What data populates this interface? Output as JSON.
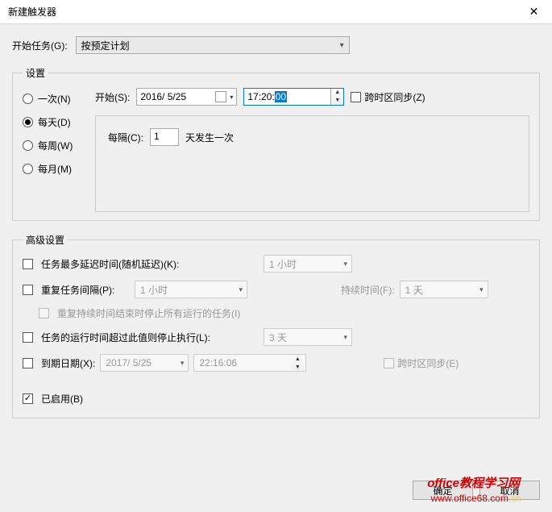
{
  "title": "新建触发器",
  "begin_task_label": "开始任务(G):",
  "begin_task_value": "按预定计划",
  "settings_legend": "设置",
  "radios": {
    "once": "一次(N)",
    "daily": "每天(D)",
    "weekly": "每周(W)",
    "monthly": "每月(M)"
  },
  "start_label": "开始(S):",
  "start_date": "2016/ 5/25",
  "start_time_prefix": "17:20:",
  "start_time_selsec": "00",
  "tz_sync_label": "跨时区同步(Z)",
  "interval_label": "每隔(C):",
  "interval_value": "1",
  "interval_suffix": "天发生一次",
  "advanced_legend": "高级设置",
  "adv": {
    "delay_label": "任务最多延迟时间(随机延迟)(K):",
    "delay_value": "1 小时",
    "repeat_label": "重复任务间隔(P):",
    "repeat_value": "1 小时",
    "duration_label": "持续时间(F):",
    "duration_value": "1 天",
    "stop_after_dur_label": "重复持续时间结束时停止所有运行的任务(I)",
    "stop_if_runs_label": "任务的运行时间超过此值则停止执行(L):",
    "stop_if_runs_value": "3 天",
    "expire_label": "到期日期(X):",
    "expire_date": "2017/ 5/25",
    "expire_time": "22:16:06",
    "tz_sync2_label": "跨时区同步(E)",
    "enabled_label": "已启用(B)"
  },
  "buttons": {
    "ok": "确定",
    "cancel": "取消"
  },
  "watermark1": "office教程学习网",
  "watermark2": "www.office68.com",
  "watermark2_suffix": ".cn"
}
